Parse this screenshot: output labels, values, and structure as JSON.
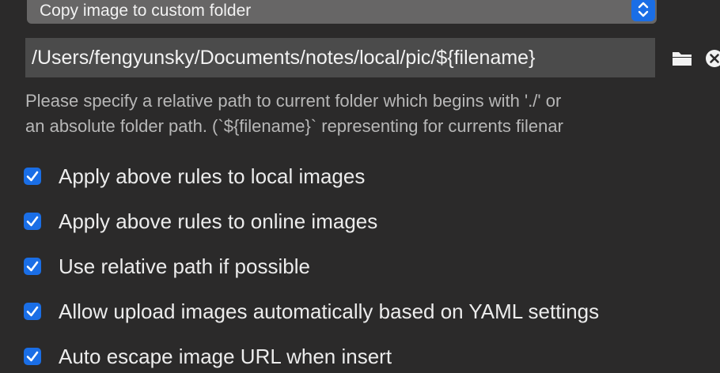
{
  "select": {
    "label": "Copy image to custom folder",
    "stepper_icon": "up-down-chevron-icon",
    "accent_color": "#1a6ee6"
  },
  "path": {
    "value": "/Users/fengyunsky/Documents/notes/local/pic/${filename}",
    "folder_icon": "folder-icon",
    "clear_icon": "clear-circle-icon"
  },
  "help": {
    "line1": " Please specify a relative path to current folder which begins with './' or",
    "line2": "an absolute folder path. (`${filename}` representing for currents filenar"
  },
  "options": [
    {
      "label": "Apply above rules to local images",
      "checked": true
    },
    {
      "label": "Apply above rules to online images",
      "checked": true
    },
    {
      "label": "Use relative path if possible",
      "checked": true
    },
    {
      "label": "Allow upload images automatically based on YAML settings",
      "checked": true
    },
    {
      "label": "Auto escape image URL when insert",
      "checked": true
    }
  ]
}
